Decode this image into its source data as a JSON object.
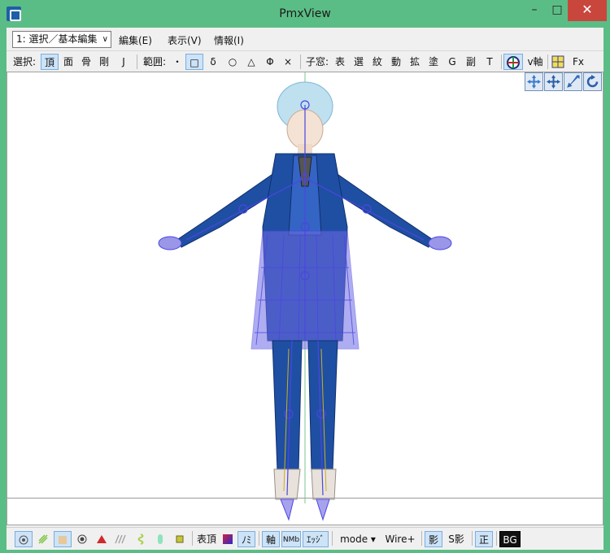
{
  "window": {
    "title": "PmxView"
  },
  "menubar": {
    "mode": "1: 選択／基本編集",
    "items": [
      "編集(E)",
      "表示(V)",
      "情報(I)"
    ]
  },
  "toolbar": {
    "select_label": "選択:",
    "select_items": [
      "頂",
      "面",
      "骨",
      "剛",
      "J"
    ],
    "range_label": "範囲:",
    "range_items": [
      "・",
      "□",
      "δ",
      "○",
      "△",
      "Φ",
      "×"
    ],
    "child_label": "子窓:",
    "child_items": [
      "表",
      "選",
      "紋",
      "動",
      "拡",
      "塗",
      "G",
      "副",
      "T"
    ],
    "axis_label": "v軸",
    "fx_label": "Fx"
  },
  "statusbar": {
    "surface_label": "表頂",
    "nomi_label": "ﾉﾐ",
    "axis_label": "軸",
    "nmb_label": "NMb",
    "edge_label": "ｴｯｼﾞ",
    "mode_label": "mode ▾",
    "wire_label": "Wire+",
    "shadow_label": "影",
    "sshadow_label": "S影",
    "front_label": "正",
    "bg_label": "BG"
  },
  "colors": {
    "titlebar": "#5bbd86",
    "close": "#c9463d",
    "selected": "#cde3f7",
    "bone": "#4b46e0",
    "coat": "#1f4fa3"
  }
}
